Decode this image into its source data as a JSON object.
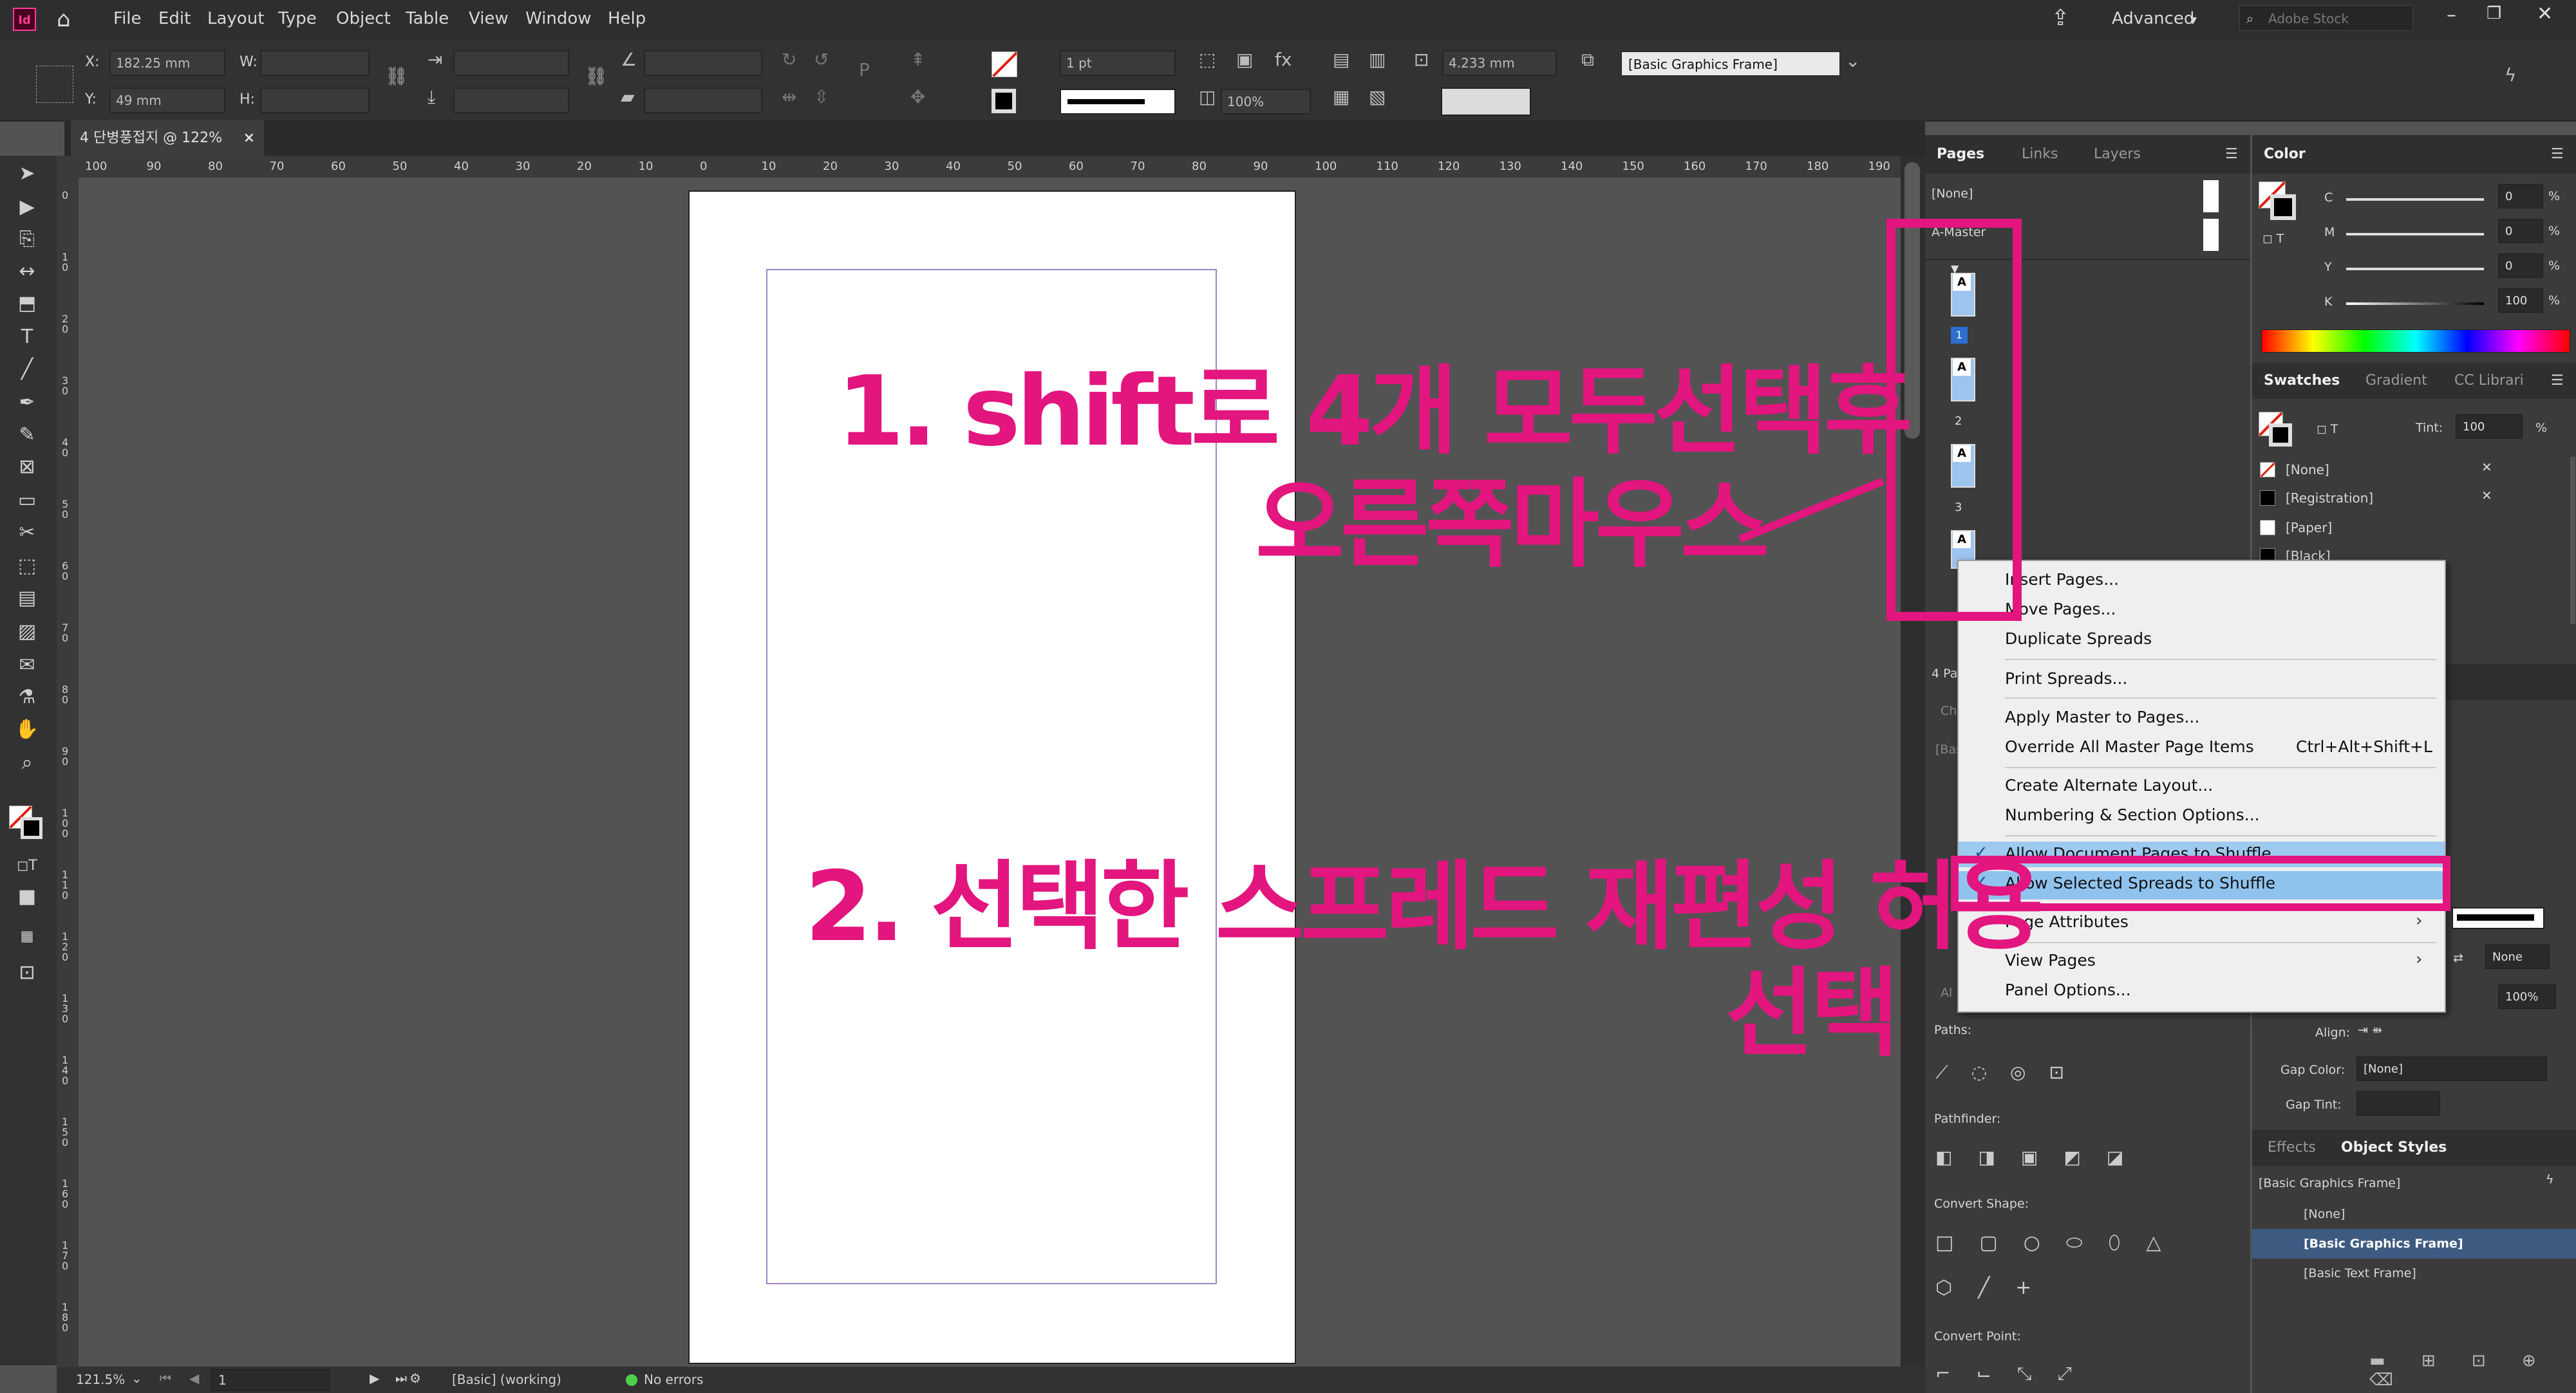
{
  "app": {
    "logo": "Id",
    "menu": [
      "File",
      "Edit",
      "Layout",
      "Type",
      "Object",
      "Table",
      "View",
      "Window",
      "Help"
    ],
    "workspace": "Advanced",
    "search_placeholder": "Adobe Stock"
  },
  "control_bar": {
    "x_label": "X:",
    "x_value": "182.25 mm",
    "y_label": "Y:",
    "y_value": "49 mm",
    "w_label": "W:",
    "h_label": "H:",
    "stroke_weight": "1 pt",
    "opacity": "100%",
    "spacing_value": "4.233 mm",
    "object_style": "[Basic Graphics Frame]"
  },
  "document": {
    "tab_title": "4 단병풍접지 @ 122%",
    "close_glyph": "×"
  },
  "ruler": {
    "h_ticks": [
      "100",
      "90",
      "80",
      "70",
      "60",
      "50",
      "40",
      "30",
      "20",
      "10",
      "0",
      "10",
      "20",
      "30",
      "40",
      "50",
      "60",
      "70",
      "80",
      "90",
      "100",
      "110",
      "120",
      "130",
      "140",
      "150",
      "160",
      "170",
      "180",
      "190"
    ],
    "v_ticks": [
      "0",
      "1 0",
      "2 0",
      "3 0",
      "4 0",
      "5 0",
      "6 0",
      "7 0",
      "8 0",
      "9 0",
      "1 0 0",
      "1 1 0",
      "1 2 0",
      "1 3 0",
      "1 4 0",
      "1 5 0",
      "1 6 0",
      "1 7 0",
      "1 8 0"
    ]
  },
  "status_bar": {
    "zoom": "121.5%",
    "page": "1",
    "master": "[Basic] (working)",
    "preflight": "No errors"
  },
  "pages_panel": {
    "tabs": [
      "Pages",
      "Links",
      "Layers"
    ],
    "none_master": "[None]",
    "a_master": "A-Master",
    "page_numbers": [
      "1",
      "2",
      "3"
    ],
    "thumb_label": "A",
    "footer_text": "4 Pa",
    "partial_1": "Ch",
    "partial_2": "[Bas",
    "partial_3": "Al"
  },
  "pathfinder": {
    "paths_label": "Paths:",
    "pathfinder_label": "Pathfinder:",
    "convert_shape_label": "Convert Shape:",
    "convert_point_label": "Convert Point:"
  },
  "color_panel": {
    "tab": "Color",
    "channels": [
      {
        "label": "C",
        "value": "0"
      },
      {
        "label": "M",
        "value": "0"
      },
      {
        "label": "Y",
        "value": "0"
      },
      {
        "label": "K",
        "value": "100"
      }
    ],
    "percent": "%"
  },
  "swatches_panel": {
    "tabs": [
      "Swatches",
      "Gradient",
      "CC Librari"
    ],
    "tint_label": "Tint:",
    "tint_value": "100",
    "items": [
      "[None]",
      "[Registration]",
      "[Paper]",
      "[Black]"
    ]
  },
  "stroke_panel": {
    "gap_color_label": "Gap Color:",
    "gap_color_value": "[None]",
    "gap_tint_label": "Gap Tint:",
    "align_label": "Align:",
    "none_value": "None",
    "percent_value": "100%"
  },
  "object_styles_panel": {
    "tabs": [
      "Effects",
      "Object Styles"
    ],
    "current": "[Basic Graphics Frame]",
    "items": [
      "[None]",
      "[Basic Graphics Frame]",
      "[Basic Text Frame]"
    ]
  },
  "context_menu": {
    "items": [
      {
        "label": "Insert Pages..."
      },
      {
        "label": "Move Pages..."
      },
      {
        "label": "Duplicate Spreads"
      },
      {
        "label": "Print Spreads..."
      },
      {
        "label": "Apply Master to Pages..."
      },
      {
        "label": "Override All Master Page Items",
        "shortcut": "Ctrl+Alt+Shift+L"
      },
      {
        "label": "Create Alternate Layout..."
      },
      {
        "label": "Numbering & Section Options..."
      },
      {
        "label": "Allow Document Pages to Shuffle"
      },
      {
        "label": "Allow Selected Spreads to Shuffle"
      },
      {
        "label": "Page Attributes"
      },
      {
        "label": "View Pages"
      },
      {
        "label": "Panel Options..."
      }
    ],
    "check_glyph": "✓",
    "submenu_glyph": "›"
  },
  "annotations": {
    "step1_line1": "1. shift로 4개 모두선택후",
    "step1_line2": "오른쪽마우스",
    "step2_line1": "2. 선택한 스프레드 재편성 허용",
    "step2_line2": "선택",
    "color": "#e3157f"
  }
}
